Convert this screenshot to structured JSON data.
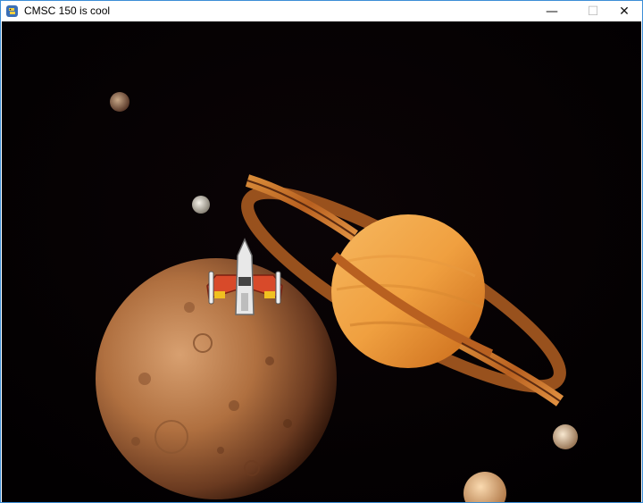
{
  "window": {
    "title": "CMSC 150 is cool",
    "app_icon": "python-snake-icon",
    "controls": {
      "minimize_glyph": "—",
      "maximize_glyph": "☐",
      "close_glyph": "✕"
    }
  },
  "scene": {
    "background": "space-saturn-moons",
    "player": "player-spaceship"
  },
  "colors": {
    "space": "#040102",
    "saturn": "#f0a848",
    "ring": "#c87830",
    "moon_large": "#b87a4a",
    "ship_body": "#e8e8e8",
    "ship_wings": "#d84a2a",
    "ship_thrust": "#f0c020"
  }
}
